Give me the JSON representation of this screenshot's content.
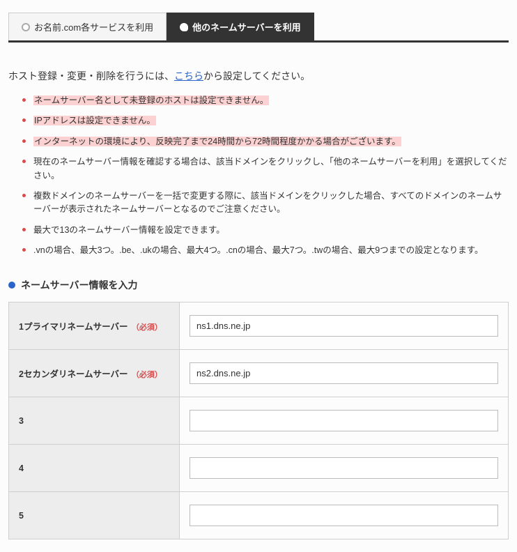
{
  "tabs": {
    "inactive": "お名前.com各サービスを利用",
    "active": "他のネームサーバーを利用"
  },
  "intro": {
    "prefix": "ホスト登録・変更・削除を行うには、",
    "link": "こちら",
    "suffix": "から設定してください。"
  },
  "notes": {
    "n1": "ネームサーバー名として未登録のホストは設定できません。",
    "n2": "IPアドレスは設定できません。",
    "n3": "インターネットの環境により、反映完了まで24時間から72時間程度かかる場合がございます。",
    "n4": "現在のネームサーバー情報を確認する場合は、該当ドメインをクリックし、「他のネームサーバーを利用」を選択してください。",
    "n5": "複数ドメインのネームサーバーを一括で変更する際に、該当ドメインをクリックした場合、すべてのドメインのネームサーバーが表示されたネームサーバーとなるのでご注意ください。",
    "n6": "最大で13のネームサーバー情報を設定できます。",
    "n7": ".vnの場合、最大3つ。.be、.ukの場合、最大4つ。.cnの場合、最大7つ。.twの場合、最大9つまでの設定となります。"
  },
  "section_title": "ネームサーバー情報を入力",
  "required_label": "（必須）",
  "rows": {
    "r1": {
      "label": "1プライマリネームサーバー",
      "value": "ns1.dns.ne.jp",
      "required": true
    },
    "r2": {
      "label": "2セカンダリネームサーバー",
      "value": "ns2.dns.ne.jp",
      "required": true
    },
    "r3": {
      "label": "3",
      "value": "",
      "required": false
    },
    "r4": {
      "label": "4",
      "value": "",
      "required": false
    },
    "r5": {
      "label": "5",
      "value": "",
      "required": false
    }
  }
}
